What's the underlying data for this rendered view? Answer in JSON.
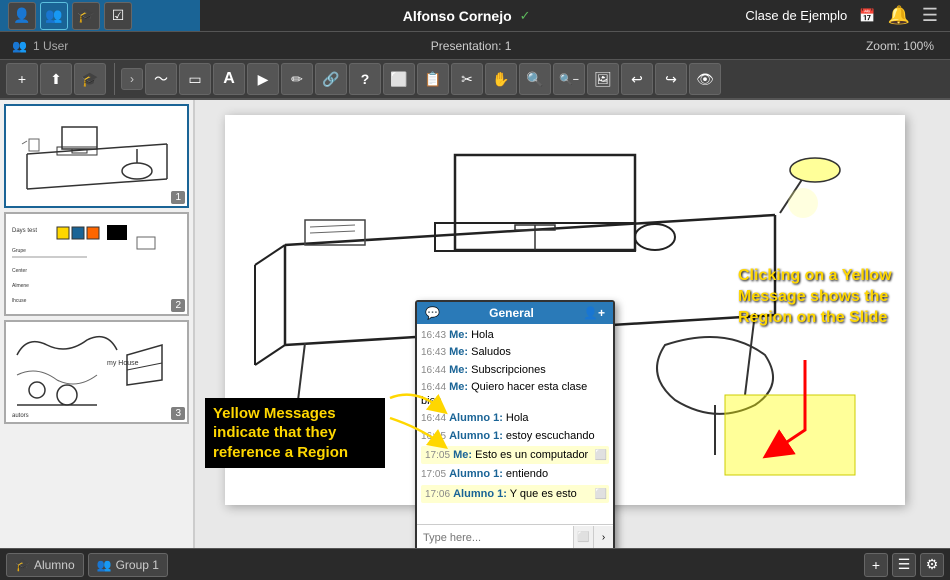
{
  "topbar": {
    "user_name": "Alfonso Cornejo",
    "class_name": "Clase de Ejemplo",
    "checkmark": "✓"
  },
  "secondbar": {
    "users": "1 User",
    "presentation": "Presentation: 1",
    "zoom": "Zoom: 100%"
  },
  "toolbar": {
    "add_label": "+",
    "upload_label": "⬆",
    "grad_label": "🎓",
    "chevron_label": "›",
    "tools": [
      "〜",
      "▭",
      "A",
      "▶",
      "✏",
      "🔗",
      "?",
      "⬜",
      "📋",
      "✂",
      "✋",
      "🔍+",
      "🔍-",
      "🖼",
      "↩",
      "↪",
      "👁"
    ]
  },
  "slides": [
    {
      "num": "1",
      "active": true
    },
    {
      "num": "2",
      "active": false
    },
    {
      "num": "3",
      "active": false
    }
  ],
  "chat": {
    "header": "General",
    "messages": [
      {
        "time": "16:43",
        "sender": "Me:",
        "text": "Hola",
        "yellow": false
      },
      {
        "time": "16:43",
        "sender": "Me:",
        "text": "Saludos",
        "yellow": false
      },
      {
        "time": "16:44",
        "sender": "Me:",
        "text": "Subscripciones",
        "yellow": false
      },
      {
        "time": "16:44",
        "sender": "Me:",
        "text": "Quiero hacer esta clase bien",
        "yellow": false
      },
      {
        "time": "16:44",
        "sender": "Alumno 1:",
        "text": "Hola",
        "yellow": false
      },
      {
        "time": "16:45",
        "sender": "Alumno 1:",
        "text": "estoy escuchando",
        "yellow": false
      },
      {
        "time": "17:05",
        "sender": "Me:",
        "text": "Esto es un computador",
        "yellow": true
      },
      {
        "time": "17:05",
        "sender": "Alumno 1:",
        "text": "entiendo",
        "yellow": false
      },
      {
        "time": "17:06",
        "sender": "Alumno 1:",
        "text": "Y que es esto",
        "yellow": true
      }
    ],
    "input_placeholder": "Type here..."
  },
  "bottombar": {
    "alumno_tab": "Alumno",
    "group_tab": "Group 1",
    "add_btn": "+",
    "list_btn": "☰",
    "settings_btn": "⚙"
  },
  "annotations": {
    "callout_left": "Yellow Messages indicate that they reference a Region",
    "callout_right": "Clicking on a Yellow Message shows the Region on the Slide"
  }
}
